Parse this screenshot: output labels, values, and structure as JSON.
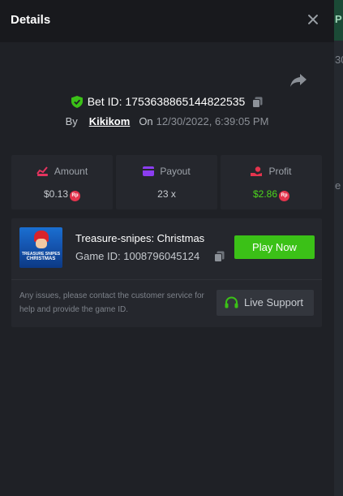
{
  "header": {
    "title": "Details"
  },
  "bet": {
    "id_text": "Bet ID: 1753638865144822535",
    "by_label": "By",
    "username": "Kikikom",
    "on_label": "On",
    "datetime": "12/30/2022, 6:39:05 PM"
  },
  "stats": {
    "amount": {
      "label": "Amount",
      "value": "$0.13",
      "currency_badge": "Rp"
    },
    "payout": {
      "label": "Payout",
      "value": "23 x"
    },
    "profit": {
      "label": "Profit",
      "value": "$2.86",
      "currency_badge": "Rp"
    }
  },
  "game": {
    "thumbnail_line1": "TREASURE SNIPES",
    "thumbnail_line2": "CHRISTMAS",
    "name": "Treasure-snipes: Christmas",
    "id_text": "Game ID: 1008796045124",
    "play_label": "Play Now",
    "note": "Any issues, please contact the customer service for help and provide the game ID.",
    "support_label": "Live Support"
  },
  "background_page": {
    "fragments": [
      "P",
      "30",
      "e"
    ]
  },
  "colors": {
    "accent_green": "#3bc117",
    "profit_green": "#4cd41c",
    "badge_red": "#e4344d",
    "panel_bg": "#1f2126"
  },
  "icons": [
    "close-icon",
    "share-icon",
    "shield-check-icon",
    "copy-icon",
    "amount-icon",
    "wallet-icon",
    "profit-icon",
    "headset-icon"
  ]
}
